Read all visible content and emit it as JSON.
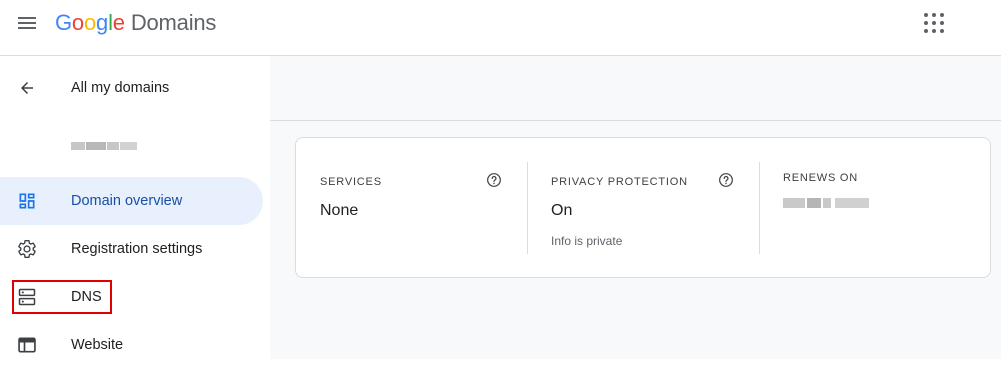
{
  "header": {
    "brand": [
      "G",
      "o",
      "o",
      "g",
      "l",
      "e"
    ],
    "product": "Domains"
  },
  "sidebar": {
    "back_label": "All my domains",
    "nav": [
      {
        "label": "Domain overview",
        "icon": "dashboard-icon",
        "active": true
      },
      {
        "label": "Registration settings",
        "icon": "gear-icon",
        "active": false
      },
      {
        "label": "DNS",
        "icon": "dns-server-icon",
        "active": false,
        "highlighted": true
      },
      {
        "label": "Website",
        "icon": "web-icon",
        "active": false
      }
    ]
  },
  "overview": {
    "services": {
      "label": "SERVICES",
      "value": "None"
    },
    "privacy": {
      "label": "PRIVACY PROTECTION",
      "value": "On",
      "sub": "Info is private"
    },
    "renews": {
      "label": "RENEWS ON"
    }
  },
  "colors": {
    "accent": "#1a73e8",
    "active_bg": "#e8f0fe",
    "highlight_box": "#e00000"
  }
}
